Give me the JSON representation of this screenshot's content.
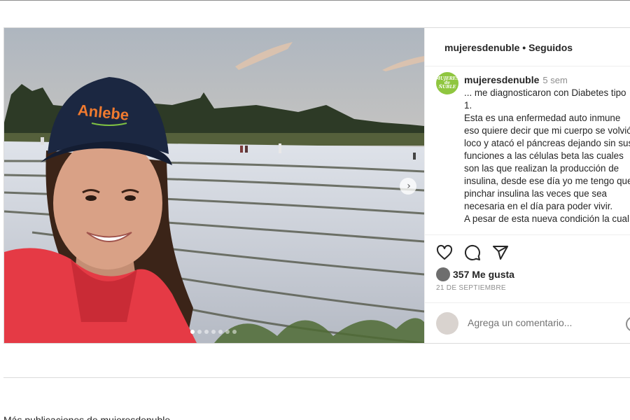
{
  "post": {
    "header_username": "mujeresdenuble",
    "header_separator": "•",
    "header_follow_status": "Seguidos",
    "avatar_text": "MUJERES de ÑUBLE",
    "caption": {
      "username": "mujeresdenuble",
      "time_ago": "5 sem",
      "text": "... me diagnosticaron con Diabetes tipo 1.\nEsta es una enfermedad auto inmune eso quiere decir que mi cuerpo se volvió loco y atacó el páncreas dejando sin sus funciones a las células beta las cuales son las que realizan la producción de insulina, desde ese día yo me tengo que pinchar insulina las veces que sea necesaria en el día para poder vivir.\nA pesar de esta nueva condición la cual"
    },
    "likes_text": "357 Me gusta",
    "date": "21 DE SEPTIEMBRE",
    "comment_placeholder": "Agrega un comentario...",
    "carousel": {
      "slides": 7,
      "active_index": 0,
      "next_glyph": "›"
    },
    "photo": {
      "cap_brand": "Anlebe"
    }
  },
  "icons": {
    "like": "heart-icon",
    "comment": "comment-icon",
    "share": "share-icon",
    "emoji": "emoji-icon",
    "next": "chevron-right-icon"
  },
  "colors": {
    "avatar_green": "#8fc63f",
    "jacket_red": "#e53a45",
    "cap_navy": "#1b2741",
    "text": "#262626",
    "muted": "#8e8e8e"
  },
  "below": {
    "cut_text": "Más publicaciones de mujeresdenuble"
  }
}
